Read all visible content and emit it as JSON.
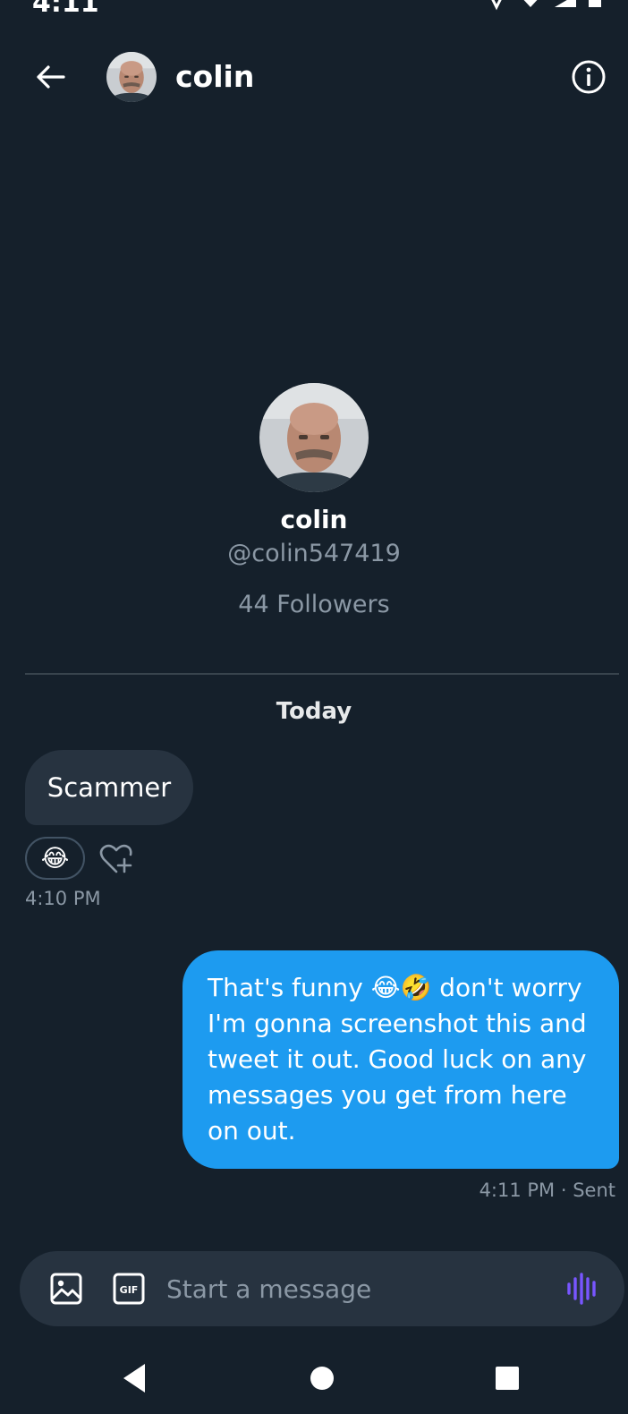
{
  "status_bar": {
    "time": "4:11"
  },
  "header": {
    "name": "colin"
  },
  "profile": {
    "name": "colin",
    "handle": "@colin547419",
    "followers": "44 Followers"
  },
  "conversation": {
    "date_label": "Today",
    "incoming": {
      "text": "Scammer",
      "reaction": "😂",
      "time": "4:10 PM"
    },
    "outgoing": {
      "text": "That's funny 😂🤣 don't worry I'm gonna screenshot this and tweet it out. Good luck on any messages you get from here on out.",
      "time": "4:11 PM · Sent"
    }
  },
  "composer": {
    "placeholder": "Start a message"
  },
  "colors": {
    "background": "#15202b",
    "bubble_incoming": "#273340",
    "bubble_outgoing": "#1d9bf0",
    "secondary_text": "#8b98a5",
    "voice_accent": "#7856ff"
  }
}
